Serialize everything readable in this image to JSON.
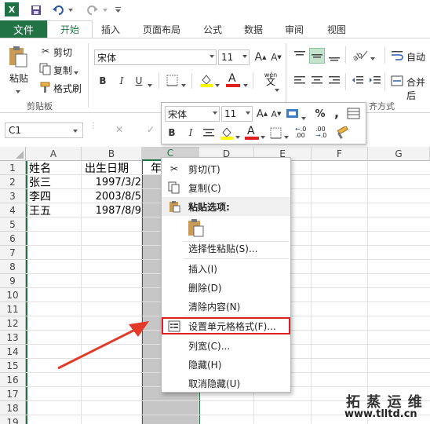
{
  "quick_access": {
    "logo_text": "X",
    "undo_icon": "undo-icon",
    "redo_icon": "redo-icon"
  },
  "tabs": {
    "file": "文件",
    "items": [
      "开始",
      "插入",
      "页面布局",
      "公式",
      "数据",
      "审阅",
      "视图"
    ]
  },
  "ribbon": {
    "paste_label": "粘贴",
    "cut_label": "剪切",
    "copy_label": "复制",
    "format_painter_label": "格式刷",
    "clipboard_group": "剪贴板",
    "font_name": "宋体",
    "font_size": "11",
    "font_color_letter": "A",
    "wen_label": "wén",
    "wrap_label": "自动",
    "merge_label": "合并后",
    "align_group": "齐方式"
  },
  "formula_bar": {
    "name_box": "C1",
    "cancel": "✕",
    "confirm": "✓"
  },
  "columns": [
    "A",
    "B",
    "C",
    "D",
    "E",
    "F",
    "G"
  ],
  "rows": [
    "1",
    "2",
    "3",
    "4",
    "5",
    "6",
    "7",
    "8",
    "9",
    "10",
    "11",
    "12",
    "13",
    "14",
    "15",
    "16",
    "17",
    "18",
    "19"
  ],
  "cells": {
    "A1": "姓名",
    "B1": "出生日期",
    "C1": "年",
    "A2": "张三",
    "B2": "1997/3/2",
    "A3": "李四",
    "B3": "2003/8/5",
    "A4": "王五",
    "B4": "1987/8/9"
  },
  "mini_toolbar": {
    "font_name": "宋体",
    "font_size": "11",
    "percent": "%",
    "comma": ",",
    "bold": "B",
    "italic": "I",
    "inc_decimal": "⁺.0 .00",
    "dec_decimal": ".00 →.0"
  },
  "context_menu": {
    "cut": "剪切(T)",
    "copy": "复制(C)",
    "paste_options": "粘贴选项:",
    "paste_special": "选择性粘贴(S)...",
    "insert": "插入(I)",
    "delete": "删除(D)",
    "clear": "清除内容(N)",
    "format_cells": "设置单元格格式(F)...",
    "column_width": "列宽(C)...",
    "hide": "隐藏(H)",
    "unhide": "取消隐藏(U)"
  },
  "watermark": {
    "line1": "拓 蒸 运 维",
    "line2": "www.tlltd.cn"
  },
  "colors": {
    "excel_green": "#217346",
    "highlight_red": "#e02020",
    "selected_column": "#c6c6c6"
  }
}
